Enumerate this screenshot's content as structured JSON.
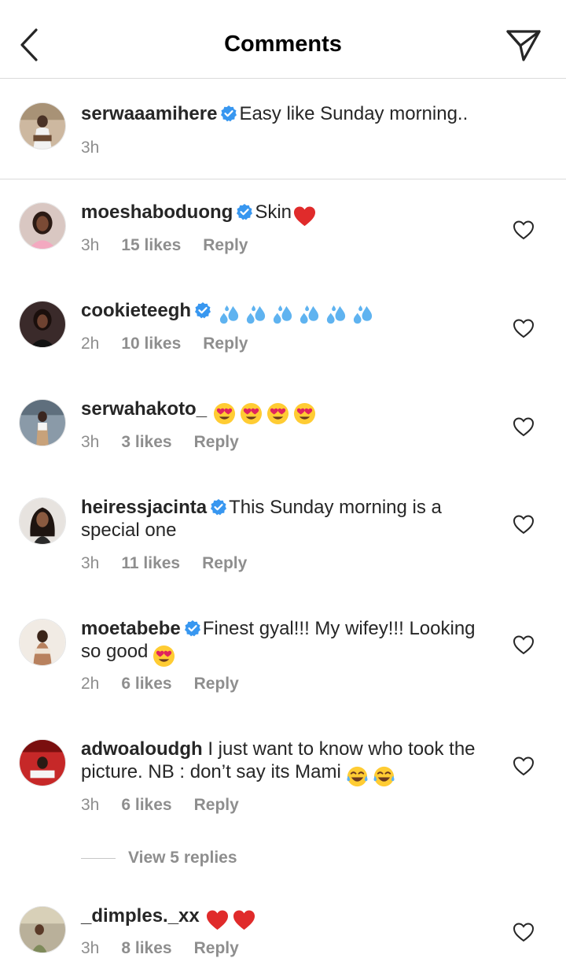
{
  "header": {
    "title": "Comments",
    "back_icon": "chevron-left-icon",
    "share_icon": "paper-plane-icon"
  },
  "caption": {
    "username": "serwaaamihere",
    "verified": true,
    "text": "Easy like Sunday morning..",
    "time": "3h"
  },
  "comments": [
    {
      "username": "moeshaboduong",
      "verified": true,
      "text": "Skin",
      "emojis": [
        "red-heart"
      ],
      "time": "3h",
      "likes": "15 likes",
      "reply": "Reply"
    },
    {
      "username": "cookieteegh",
      "verified": true,
      "text": "",
      "emojis": [
        "sweat-droplets",
        "sweat-droplets",
        "sweat-droplets",
        "sweat-droplets",
        "sweat-droplets",
        "sweat-droplets"
      ],
      "time": "2h",
      "likes": "10 likes",
      "reply": "Reply"
    },
    {
      "username": "serwahakoto_",
      "verified": false,
      "text": "",
      "emojis": [
        "heart-eyes",
        "heart-eyes",
        "heart-eyes",
        "heart-eyes"
      ],
      "time": "3h",
      "likes": "3 likes",
      "reply": "Reply"
    },
    {
      "username": "heiressjacinta",
      "verified": true,
      "text": "This Sunday morning is a special one",
      "emojis": [],
      "time": "3h",
      "likes": "11 likes",
      "reply": "Reply"
    },
    {
      "username": "moetabebe",
      "verified": true,
      "text": "Finest gyal!!! My wifey!!! Looking so good",
      "emojis": [
        "heart-eyes"
      ],
      "time": "2h",
      "likes": "6 likes",
      "reply": "Reply"
    },
    {
      "username": "adwoaloudgh",
      "verified": false,
      "text": "I just want to know who took the picture. NB : don’t say its Mami",
      "emojis": [
        "tears-of-joy",
        "tears-of-joy"
      ],
      "time": "3h",
      "likes": "6 likes",
      "reply": "Reply"
    },
    {
      "username": "_dimples._xx",
      "verified": false,
      "text": "",
      "emojis": [
        "red-heart",
        "red-heart"
      ],
      "time": "3h",
      "likes": "8 likes",
      "reply": "Reply"
    }
  ],
  "view_replies": {
    "label": "View 5 replies"
  },
  "colors": {
    "text": "#262626",
    "muted": "#8e8e8e",
    "verified": "#3897f0",
    "divider": "#dbdbdb"
  }
}
